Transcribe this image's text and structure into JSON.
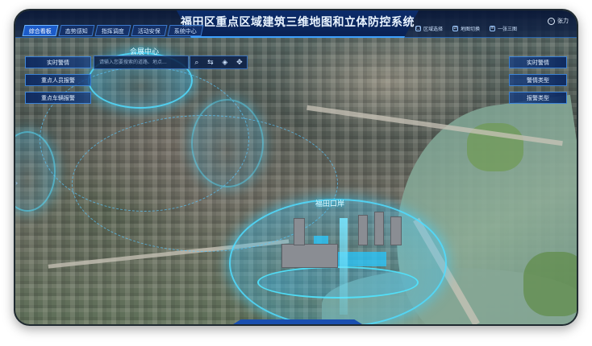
{
  "header": {
    "title": "福田区重点区域建筑三维地图和立体防控系统",
    "tabs": [
      {
        "label": "综合看板",
        "active": true
      },
      {
        "label": "态势感知",
        "active": false
      },
      {
        "label": "指挥调度",
        "active": false
      },
      {
        "label": "活动安保",
        "active": false
      },
      {
        "label": "系统中心",
        "active": false
      }
    ],
    "tools": [
      {
        "label": "区域选择",
        "icon": "area-icon"
      },
      {
        "label": "地图切换",
        "icon": "map-switch-icon"
      },
      {
        "label": "一张三图",
        "icon": "layers-icon"
      }
    ],
    "user": {
      "name": "张力",
      "icon": "user-icon"
    }
  },
  "left_panel": {
    "buttons": [
      "实时警情",
      "重点人员报警",
      "重点车辆报警"
    ]
  },
  "search": {
    "placeholder": "请输入您要搜索的道路、地点...",
    "icons": [
      "search-icon",
      "swap-icon",
      "layers-icon",
      "move-icon"
    ]
  },
  "right_panel": {
    "buttons": [
      "实时警情",
      "警情类型",
      "报警类型"
    ]
  },
  "map": {
    "labels": {
      "dome_top": "会展中心",
      "dome_main": "福田口岸"
    },
    "colors": {
      "highlight": "#28c8ff",
      "panel_bg": "#0c2860",
      "accent": "#3ea1ff"
    }
  }
}
